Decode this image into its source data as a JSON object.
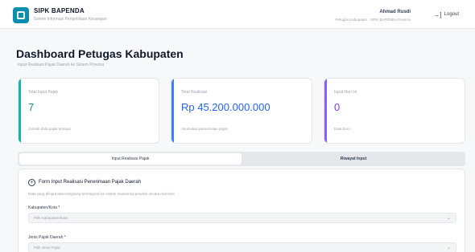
{
  "header": {
    "app_name": "SIPK BAPENDA",
    "app_subtitle": "Sistem Informasi Pengelolaan Keuangan",
    "user_name": "Ahmad Rusdi",
    "user_role": "Petugas Kabupaten · SIPK BAPENDA Provinsi",
    "logout_label": "Logout",
    "logout_icon": "→]"
  },
  "page": {
    "title": "Dashboard Petugas Kabupaten",
    "subtitle": "Input Realisasi Pajak Daerah ke Sistem Provinsi"
  },
  "cards": [
    {
      "label": "Total Input Pajak",
      "value": "7",
      "note": "Jumlah data pajak terinput",
      "accent": "#14b8a6",
      "value_color": "#0d9488"
    },
    {
      "label": "Total Realisasi",
      "value": "Rp 45.200.000.000",
      "note": "Akumulasi penerimaan pajak",
      "accent": "#3b82f6",
      "value_color": "#2563eb"
    },
    {
      "label": "Input Hari Ini",
      "value": "0",
      "note": "Data baru",
      "accent": "#8b5cf6",
      "value_color": "#7c3aed"
    }
  ],
  "tabs": {
    "input": "Input Realisasi Pajak",
    "riwayat": "Riwayat Input"
  },
  "form": {
    "icon": "plus-circle-icon",
    "title": "Form Input Realisasi Penerimaan Pajak Daerah",
    "description": "Data yang diinput akan langsung terintegrasi ke sistem monitoring provinsi secara real-time",
    "fields": [
      {
        "label": "Kabupaten/Kota *",
        "value": "Pilih Kabupaten/Kota"
      },
      {
        "label": "Jenis Pajak Daerah *",
        "value": "Pilih Jenis Pajak"
      }
    ]
  }
}
